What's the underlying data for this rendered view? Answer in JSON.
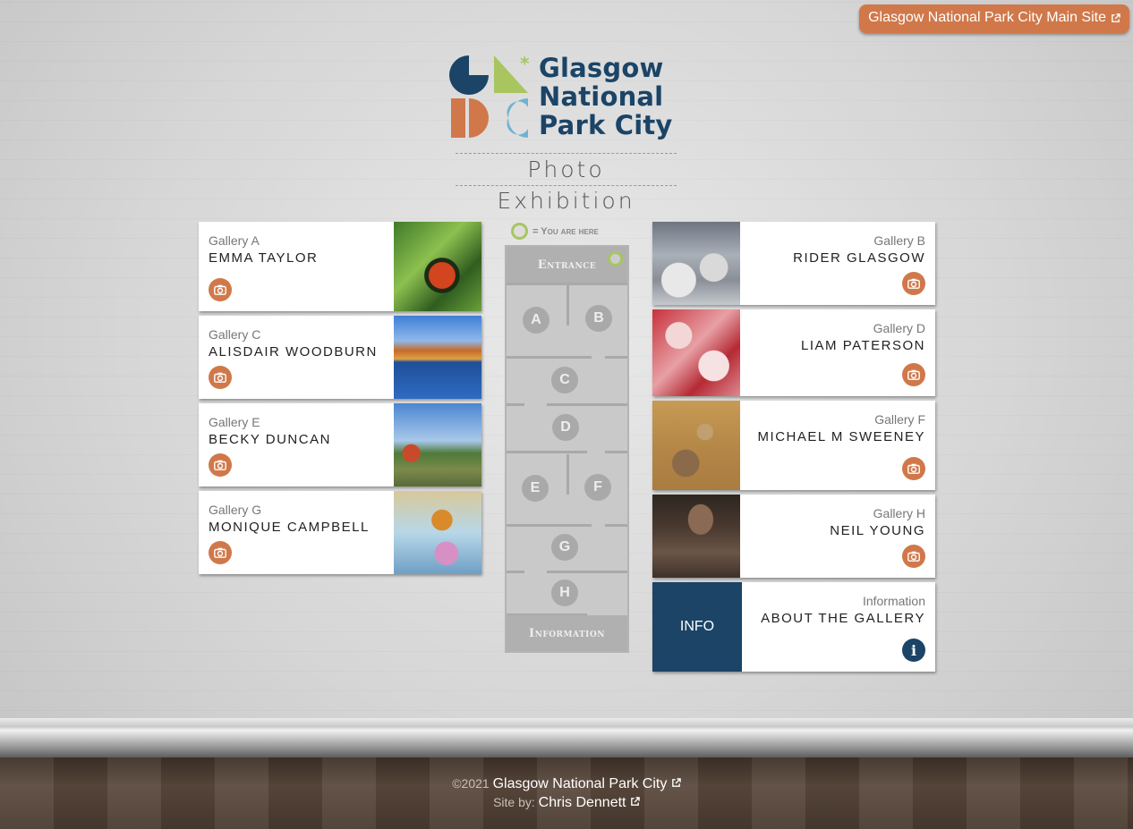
{
  "header": {
    "main_site_link": "Glasgow National Park City Main Site"
  },
  "logo": {
    "line1": "Glasgow",
    "line2": "National",
    "line3": "Park City",
    "subtitle": "Photo Exhibition"
  },
  "galleries_left": [
    {
      "gallery": "Gallery A",
      "name": "EMMA TAYLOR"
    },
    {
      "gallery": "Gallery C",
      "name": "ALISDAIR WOODBURN"
    },
    {
      "gallery": "Gallery E",
      "name": "BECKY DUNCAN"
    },
    {
      "gallery": "Gallery G",
      "name": "MONIQUE CAMPBELL"
    }
  ],
  "galleries_right": [
    {
      "gallery": "Gallery B",
      "name": "RIDER GLASGOW"
    },
    {
      "gallery": "Gallery D",
      "name": "LIAM PATERSON"
    },
    {
      "gallery": "Gallery F",
      "name": "MICHAEL M SWEENEY"
    },
    {
      "gallery": "Gallery H",
      "name": "NEIL YOUNG"
    }
  ],
  "info_card": {
    "block_label": "INFO",
    "gallery": "Information",
    "name": "ABOUT THE GALLERY"
  },
  "map": {
    "legend": "= You are here",
    "entrance": "Entrance",
    "information": "Information",
    "rooms": [
      "A",
      "B",
      "C",
      "D",
      "E",
      "F",
      "G",
      "H"
    ]
  },
  "footer": {
    "copyright": "©2021",
    "org_link": "Glasgow National Park City",
    "site_by": "Site by:",
    "author_link": "Chris Dennett"
  },
  "colors": {
    "accent": "#d0784a",
    "navy": "#1b4466",
    "green": "#a8c560",
    "light_blue": "#6fb3d2"
  }
}
